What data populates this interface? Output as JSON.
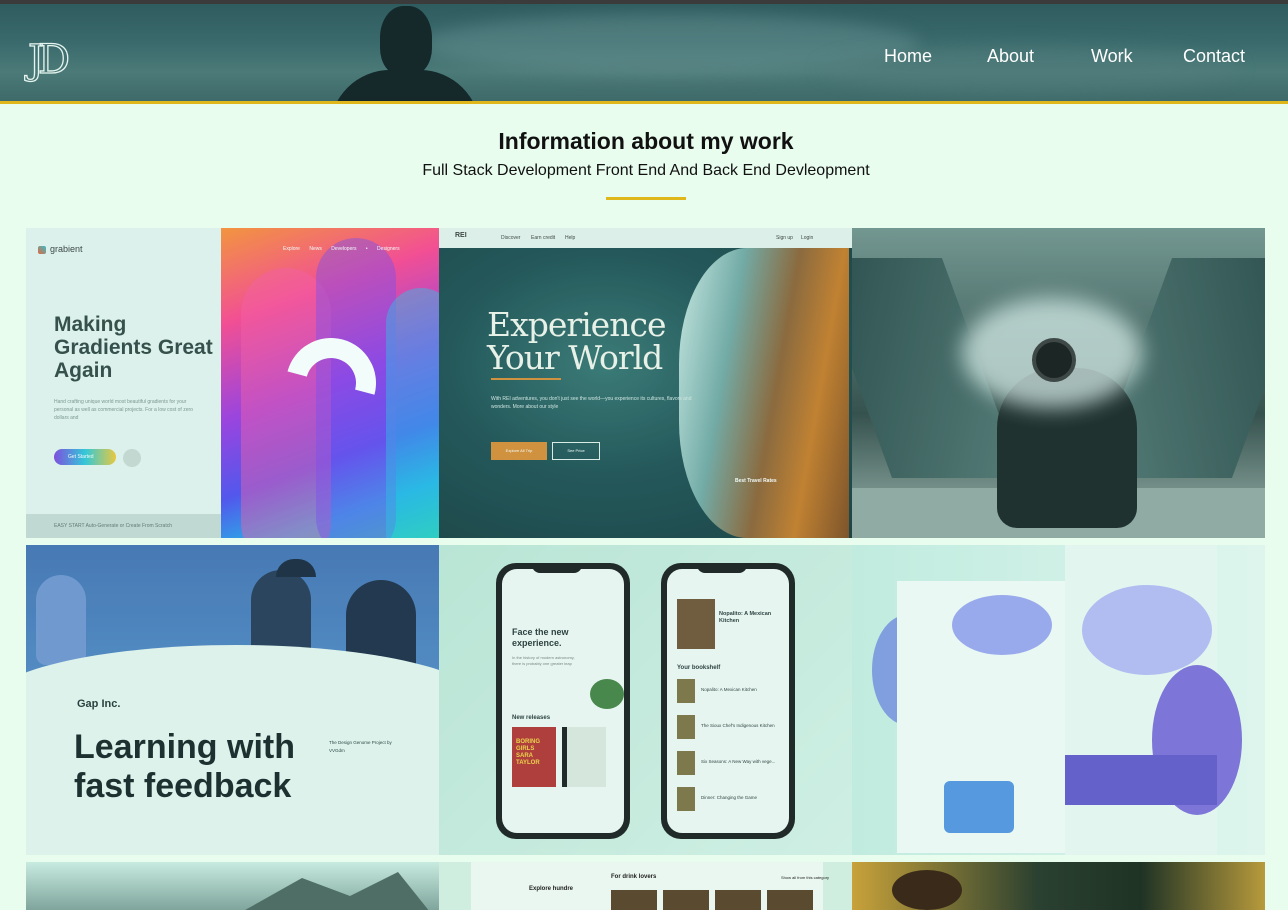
{
  "header": {
    "logo_text": "JD",
    "nav": [
      "Home",
      "About",
      "Work",
      "Contact"
    ],
    "accent_color": "#e0b71b"
  },
  "section": {
    "title": "Information about my work",
    "subtitle": "Full Stack Development Front End And Back End Devleopment"
  },
  "works": [
    {
      "brand": "grabient",
      "heading": "Making Gradients Great Again",
      "text": "Hand crafting unique world most beautiful gradients for your personal as well as commercial projects. For a low cost of zero dollars and",
      "button": "Get Started",
      "bar_text": "EASY START  Auto-Generate or Create From Scratch",
      "nav": "Explore News Developers • Designers"
    },
    {
      "brand": "REI",
      "links": [
        "Discover",
        "Earn credit",
        "Help",
        "Sign up",
        "Login"
      ],
      "heading": "Experience Your World",
      "text": "With REI adventures, you don't just see the world—you experience its cultures, flavors and wonders. More about our style",
      "button_primary": "Explore All Trip",
      "button_secondary": "See Price",
      "side_title": "Best Travel Rates"
    },
    {
      "description": "photographer"
    },
    {
      "brand": "Gap Inc.",
      "heading": "Learning with fast feedback",
      "credit": "The Design Genome Project by VVGdm"
    },
    {
      "phone1_heading": "Face the new experience.",
      "phone1_sub": "In the history of modern astronomy, there is probably one greater leap",
      "new_releases": "New releases",
      "book1": "BORING GIRLS SARA TAYLOR",
      "phone2_title": "Nopalito: A Mexican Kitchen",
      "phone2_shelf": "Your bookshelf",
      "shelf_books": [
        "Nopalito: A Mexican Kitchen",
        "The Sioux Chef's Indigenous Kitchen",
        "Six Seasons: A New Way with vege...",
        "Dinner: Changing the Game"
      ]
    },
    {
      "description": "landing page"
    },
    {
      "description": "mountains"
    },
    {
      "heading": "Explore hundre",
      "title": "For drink lovers",
      "link": "Show all from this category"
    },
    {
      "description": "people"
    }
  ]
}
